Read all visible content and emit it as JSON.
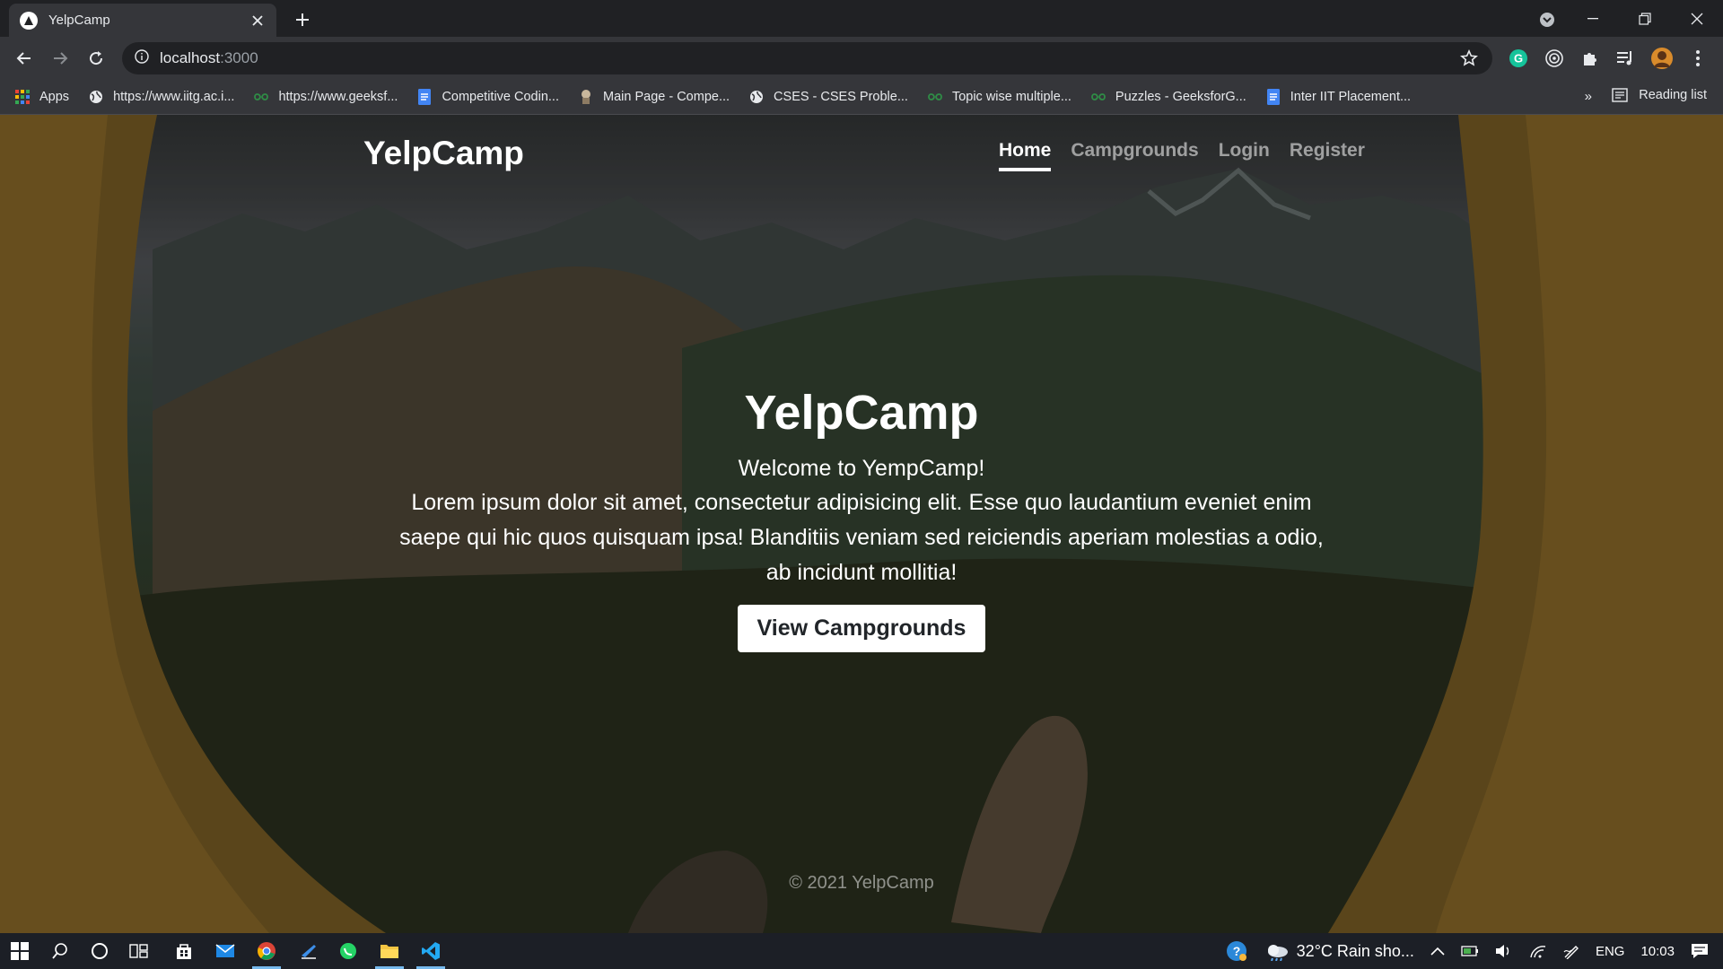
{
  "browser": {
    "tab_title": "YelpCamp",
    "url_host": "localhost",
    "url_port": ":3000",
    "bookmarks": [
      {
        "label": "Apps",
        "icon": "apps-grid-icon"
      },
      {
        "label": "https://www.iitg.ac.i...",
        "icon": "globe-icon"
      },
      {
        "label": "https://www.geeksf...",
        "icon": "gfg-icon"
      },
      {
        "label": "Competitive Codin...",
        "icon": "doc-icon"
      },
      {
        "label": "Main Page - Compe...",
        "icon": "page-icon"
      },
      {
        "label": "CSES - CSES Proble...",
        "icon": "globe-icon"
      },
      {
        "label": "Topic wise multiple...",
        "icon": "gfg-icon"
      },
      {
        "label": "Puzzles - GeeksforG...",
        "icon": "gfg-icon"
      },
      {
        "label": "Inter IIT Placement...",
        "icon": "doc-icon"
      }
    ],
    "bookmarks_more": "»",
    "reading_list": "Reading list"
  },
  "site": {
    "brand": "YelpCamp",
    "nav": [
      {
        "label": "Home",
        "active": true
      },
      {
        "label": "Campgrounds",
        "active": false
      },
      {
        "label": "Login",
        "active": false
      },
      {
        "label": "Register",
        "active": false
      }
    ],
    "hero": {
      "title": "YelpCamp",
      "welcome": "Welcome to YempCamp!",
      "lead": "Lorem ipsum dolor sit amet, consectetur adipisicing elit. Esse quo laudantium eveniet enim saepe qui hic quos quisquam ipsa! Blanditiis veniam sed reiciendis aperiam molestias a odio, ab incidunt mollitia!",
      "button": "View Campgrounds"
    },
    "footer": "© 2021 YelpCamp"
  },
  "taskbar": {
    "weather": "32°C  Rain sho...",
    "language": "ENG",
    "time": "10:03"
  },
  "colors": {
    "chrome_dark": "#202124",
    "chrome_toolbar": "#35363a",
    "taskbar": "#1c1f26",
    "accent": "#76b9ed"
  }
}
